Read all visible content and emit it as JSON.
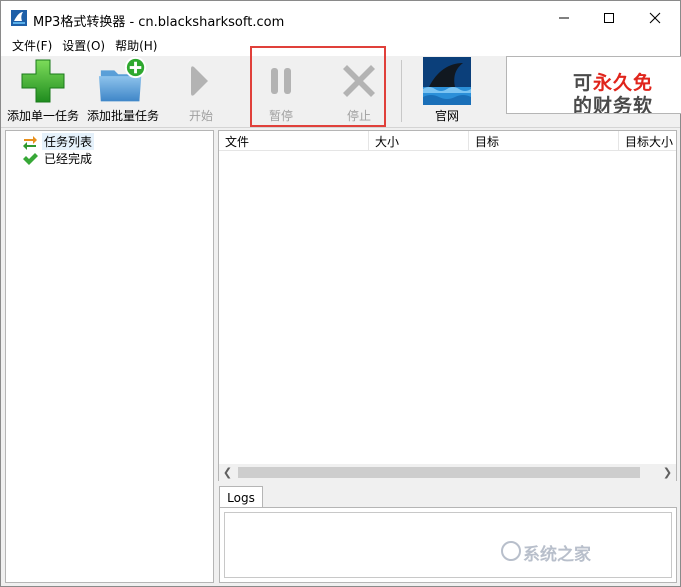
{
  "window": {
    "title": "MP3格式转换器 - cn.blacksharksoft.com",
    "app_icon": "shark-icon",
    "controls": [
      "minimize-icon",
      "maximize-icon",
      "close-icon"
    ]
  },
  "menu": {
    "items": [
      {
        "label": "文件(F)"
      },
      {
        "label": "设置(O)"
      },
      {
        "label": "帮助(H)"
      }
    ]
  },
  "toolbar": {
    "add_single": {
      "label": "添加单一任务",
      "icon": "green-plus-icon"
    },
    "add_batch": {
      "label": "添加批量任务",
      "icon": "folder-add-icon"
    },
    "start": {
      "label": "开始",
      "icon": "play-icon",
      "enabled": false
    },
    "pause": {
      "label": "暂停",
      "icon": "pause-icon",
      "enabled": false
    },
    "stop": {
      "label": "停止",
      "icon": "stop-x-icon",
      "enabled": false
    },
    "website": {
      "label": "官网",
      "icon": "shark-fin-icon"
    }
  },
  "ad": {
    "line1_prefix": "可",
    "line1_accent": "永久免",
    "line2": "的财务软"
  },
  "tree": {
    "items": [
      {
        "label": "任务列表",
        "icon": "swap-arrows-icon",
        "selected": true
      },
      {
        "label": "已经完成",
        "icon": "checkmark-icon",
        "selected": false
      }
    ]
  },
  "list": {
    "columns": [
      "文件",
      "大小",
      "目标",
      "目标大小"
    ]
  },
  "logs": {
    "tab_label": "Logs"
  },
  "watermark": {
    "text": "系统之家"
  },
  "colors": {
    "highlight": "#e0403a",
    "ad_accent": "#e0251c",
    "plus_green": "#2fa82f"
  }
}
